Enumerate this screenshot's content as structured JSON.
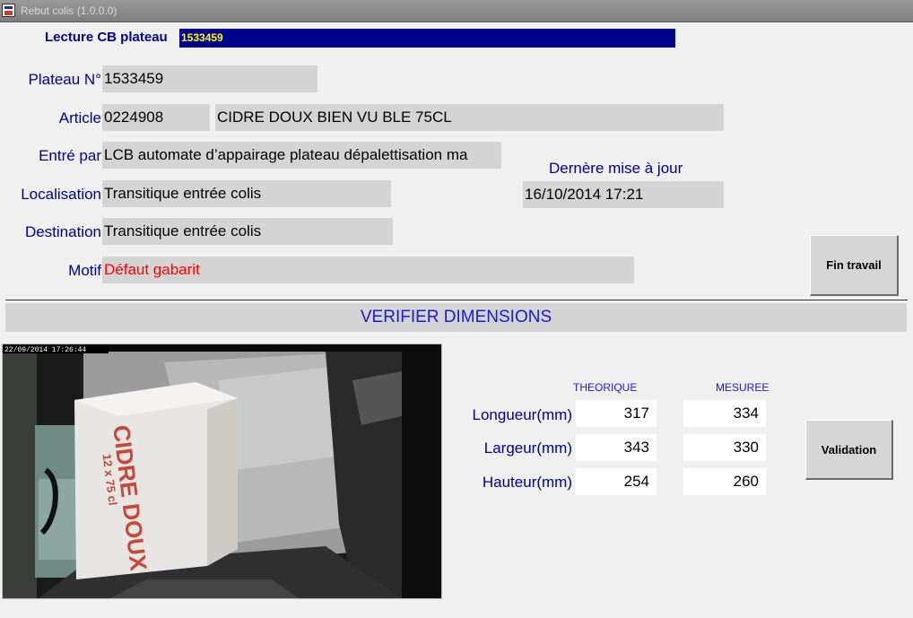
{
  "window": {
    "title": "Rebut colis (1.0.0.0)"
  },
  "scan": {
    "label": "Lecture CB plateau",
    "value": "1533459"
  },
  "plateau": {
    "label": "Plateau N°",
    "value": "1533459"
  },
  "article": {
    "label": "Article",
    "code": "0224908",
    "description": "CIDRE DOUX BIEN VU BLE 75CL"
  },
  "entered_by": {
    "label": "Entré par",
    "value": "LCB automate d’appairage plateau dépalettisation ma"
  },
  "last_update": {
    "label": "Dernère mise à jour",
    "value": "16/10/2014 17:21"
  },
  "location": {
    "label": "Localisation",
    "value": "Transitique entrée colis"
  },
  "destination": {
    "label": "Destination",
    "value": "Transitique entrée colis"
  },
  "reason": {
    "label": "Motif",
    "value": "Défaut gabarit",
    "color": "#ff0000"
  },
  "buttons": {
    "end_work": "Fin travail",
    "validate": "Validation"
  },
  "verify": {
    "title": "VERIFIER DIMENSIONS"
  },
  "camera": {
    "timestamp": "22/09/2014 17:26:44",
    "box_text": "CIDRE DOUX",
    "box_subtext": "12 x 75 cl"
  },
  "dimensions": {
    "col_theoretical": "THEORIQUE",
    "col_measured": "MESUREE",
    "rows": [
      {
        "label": "Longueur(mm)",
        "theoretical": "317",
        "measured": "334"
      },
      {
        "label": "Largeur(mm)",
        "theoretical": "343",
        "measured": "330"
      },
      {
        "label": "Hauteur(mm)",
        "theoretical": "254",
        "measured": "260"
      }
    ]
  }
}
